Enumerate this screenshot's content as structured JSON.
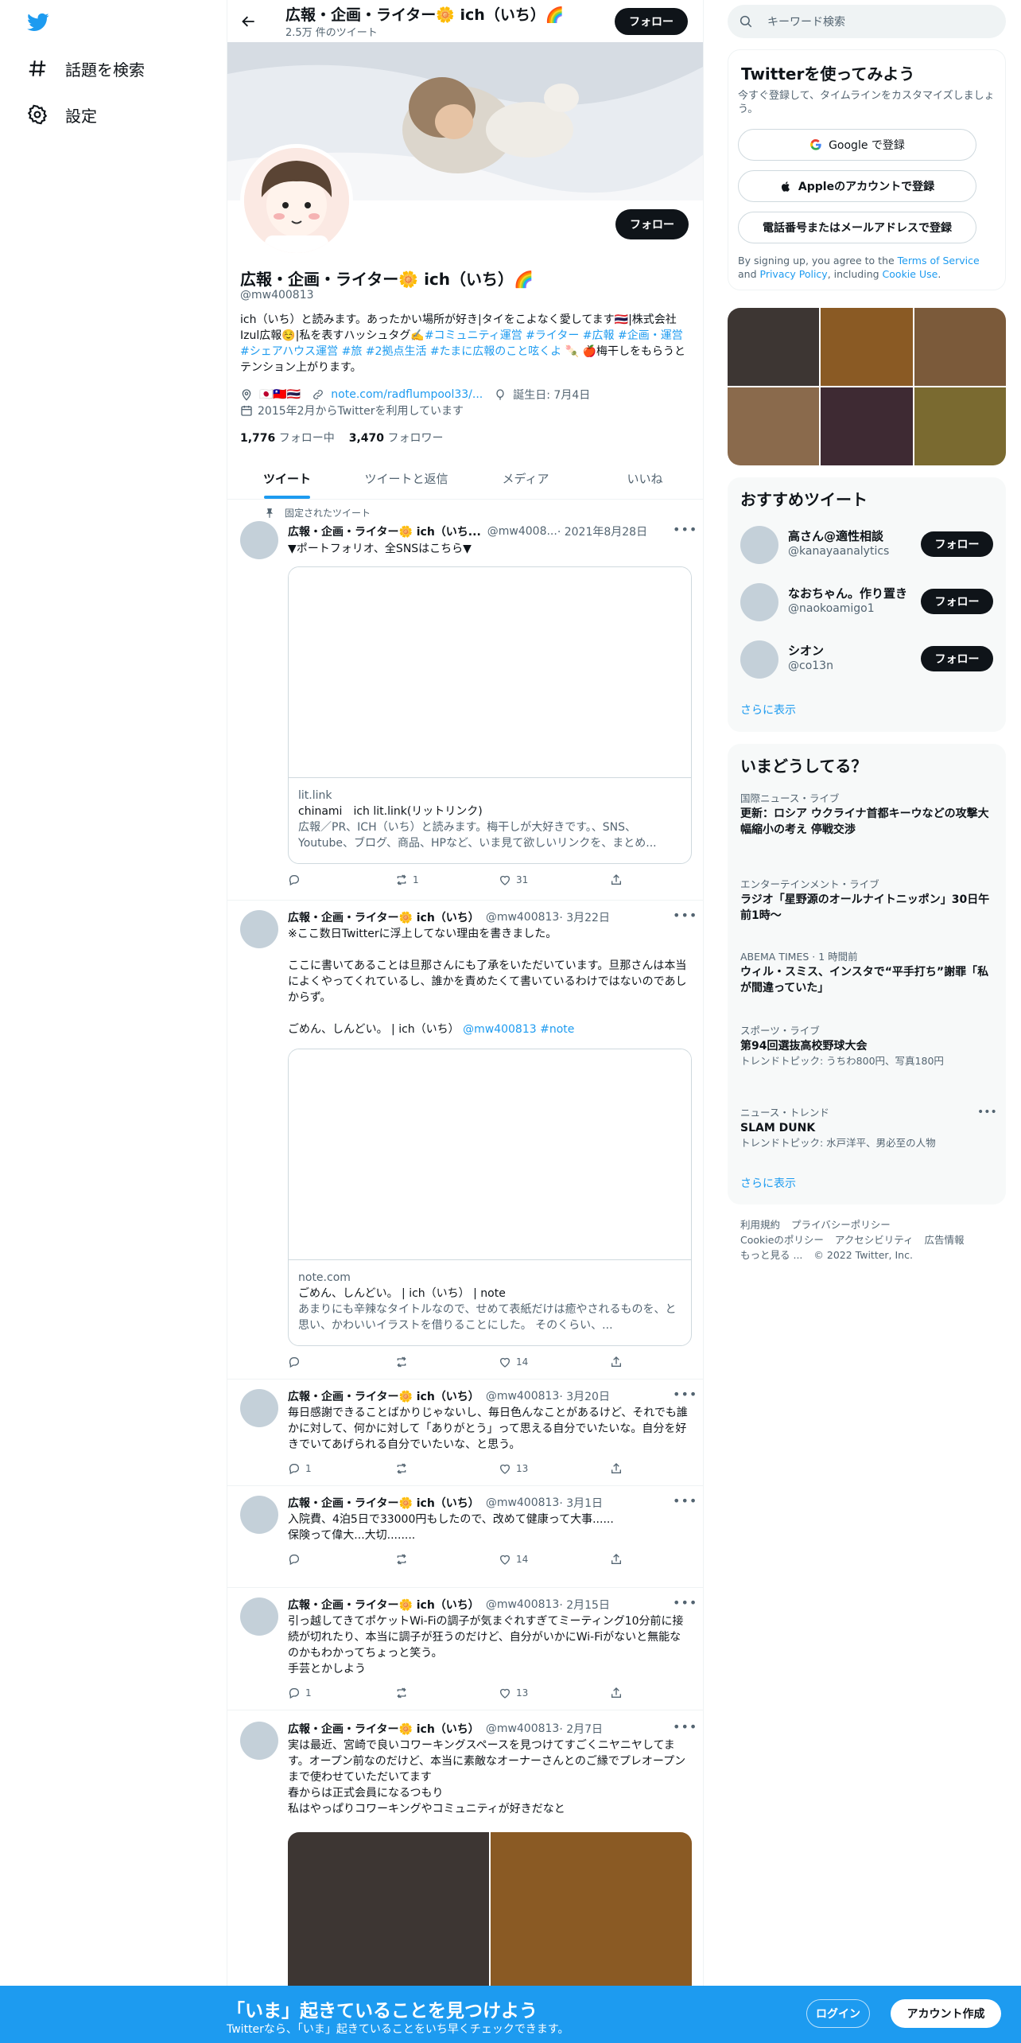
{
  "nav": {
    "explore_label": "話題を検索",
    "settings_label": "設定"
  },
  "topbar": {
    "name": "広報・企画・ライター🌼 ich（いち）🌈",
    "tweet_count": "2.5万 件のツイート",
    "follow_label": "フォロー"
  },
  "profile": {
    "name": "広報・企画・ライター🌼 ich（いち）🌈",
    "handle": "@mw400813",
    "follow_label": "フォロー",
    "bio_plain": "ich（いち）と読みます。あったかい場所が好き|タイをこよなく愛してます🇹🇭|株式会社Izul広報☺️|私を表すハッシュタグ✍️",
    "bio_tags": "#コミュニティ運営 #ライター #広報 #企画・運営 #シェアハウス運営 #旅 #2拠点生活 #たまに広報のこと呟くよ",
    "bio_tail": " 🍡 🍎梅干しをもらうとテンション上がります。",
    "location": "🇯🇵🇹🇼🇹🇭",
    "url": "note.com/radflumpool33/...",
    "birthday": "誕生日: 7月4日",
    "joined": "2015年2月からTwitterを利用しています",
    "following_count": "1,776",
    "following_label": "フォロー中",
    "followers_count": "3,470",
    "followers_label": "フォロワー"
  },
  "tabs": [
    "ツイート",
    "ツイートと返信",
    "メディア",
    "いいね"
  ],
  "pinned_label": "固定されたツイート",
  "tweets": [
    {
      "name": "広報・企画・ライター🌼 ich（いち...",
      "handle": "@mw4008...",
      "date": "· 2021年8月28日",
      "text": "▼ポートフォリオ、全SNSはこちら▼",
      "card": {
        "domain": "lit.link",
        "title": "chinami　ich lit.link(リットリンク)",
        "desc": "広報／PR、ICH（いち）と読みます。梅干しが大好きです。、SNS、Youtube、ブログ、商品、HPなど、いま見て欲しいリンクを、まとめ..."
      },
      "reply": "",
      "retweet": "1",
      "like": "31"
    },
    {
      "name": "広報・企画・ライター🌼 ich（いち）",
      "handle": "@mw400813",
      "date": "· 3月22日",
      "text": "※ここ数日Twitterに浮上してない理由を書きました。\n\nここに書いてあることは旦那さんにも了承をいただいています。旦那さんは本当によくやってくれているし、誰かを責めたくて書いているわけではないのであしからず。\n\nごめん、しんどい。 | ich（いち）",
      "text_link": "@mw400813 #note",
      "card": {
        "domain": "note.com",
        "title": "ごめん、しんどい。 | ich（いち） | note",
        "desc": "あまりにも辛辣なタイトルなので、せめて表紙だけは癒やされるものを、と思い、かわいいイラストを借りることにした。 そのくらい、..."
      },
      "reply": "",
      "retweet": "",
      "like": "14"
    },
    {
      "name": "広報・企画・ライター🌼 ich（いち）",
      "handle": "@mw400813",
      "date": "· 3月20日",
      "text": "毎日感謝できることばかりじゃないし、毎日色んなことがあるけど、それでも誰かに対して、何かに対して「ありがとう」って思える自分でいたいな。自分を好きでいてあげられる自分でいたいな、と思う。",
      "reply": "1",
      "retweet": "",
      "like": "13"
    },
    {
      "name": "広報・企画・ライター🌼 ich（いち）",
      "handle": "@mw400813",
      "date": "· 3月1日",
      "text": "入院費、4泊5日で33000円もしたので、改めて健康って大事......\n保険って偉大...大切........",
      "reply": "",
      "retweet": "",
      "like": "14"
    },
    {
      "name": "広報・企画・ライター🌼 ich（いち）",
      "handle": "@mw400813",
      "date": "· 2月15日",
      "text": "引っ越してきてポケットWi-Fiの調子が気まぐれすぎてミーティング10分前に接続が切れたり、本当に調子が狂うのだけど、自分がいかにWi-Fiがないと無能なのかもわかってちょっと笑う。\n手芸とかしよう",
      "reply": "1",
      "retweet": "",
      "like": "13"
    },
    {
      "name": "広報・企画・ライター🌼 ich（いち）",
      "handle": "@mw400813",
      "date": "· 2月7日",
      "text": "実は最近、宮崎で良いコワーキングスペースを見つけてすごくニヤニヤしてます。オープン前なのだけど、本当に素敵なオーナーさんとのご縁でプレオープンまで使わせていただいてます\n春からは正式会員になるつもり\n私はやっぱりコワーキングやコミュニティが好きだなと",
      "reply": "",
      "retweet": "",
      "like": ""
    }
  ],
  "search": {
    "placeholder": "キーワード検索"
  },
  "try_box": {
    "title": "Twitterを使ってみよう",
    "sub": "今すぐ登録して、タイムラインをカスタマイズしましょう。",
    "google_label": "Google で登録",
    "apple_label": "Appleのアカウントで登録",
    "phone_label": "電話番号またはメールアドレスで登録",
    "legal_pre": "By signing up, you agree to the ",
    "tos": "Terms of Service",
    "legal_and": " and ",
    "privacy": "Privacy Policy",
    "legal_mid": ", including ",
    "cookie": "Cookie Use",
    "legal_end": "."
  },
  "media_tile_colors": [
    "#3d3633",
    "#8a5a24",
    "#7b5a3a",
    "#8a6a4c",
    "#3e2a33",
    "#7a6a30"
  ],
  "recommend": {
    "title": "おすすめツイート",
    "follow_label": "フォロー",
    "users": [
      {
        "name": "高さん@適性相談",
        "handle": "@kanayaanalytics"
      },
      {
        "name": "なおちゃん。作り置き",
        "handle": "@naokoamigo1"
      },
      {
        "name": "シオン",
        "handle": "@co13n"
      }
    ],
    "more": "さらに表示"
  },
  "trends": {
    "title": "いまどうしてる？",
    "items": [
      {
        "cat": "国際ニュース・ライブ",
        "title": "更新：ロシア ウクライナ首都キーウなどの攻撃大幅縮小の考え 停戦交渉",
        "sub": ""
      },
      {
        "cat": "エンターテインメント・ライブ",
        "title": "ラジオ「星野源のオールナイトニッポン」30日午前1時〜",
        "sub": ""
      },
      {
        "cat": "ABEMA TIMES · 1 時間前",
        "title": "ウィル・スミス、インスタで“平手打ち”謝罪「私が間違っていた」",
        "sub": ""
      },
      {
        "cat": "スポーツ・ライブ",
        "title": "第94回選抜高校野球大会",
        "sub": "トレンドトピック: うちわ800円、写真180円"
      },
      {
        "cat": "ニュース・トレンド",
        "title": "SLAM DUNK",
        "sub": "トレンドトピック: 水戸洋平、男必至の人物"
      }
    ],
    "more": "さらに表示"
  },
  "footer": {
    "links": [
      "利用規約",
      "プライバシーポリシー",
      "Cookieのポリシー",
      "アクセシビリティ",
      "広告情報",
      "もっと見る ..."
    ],
    "copyright": "© 2022 Twitter, Inc."
  },
  "bottom": {
    "title": "「いま」起きていることを見つけよう",
    "sub": "Twitterなら、「いま」起きていることをいち早くチェックできます。",
    "login": "ログイン",
    "signup": "アカウント作成"
  },
  "colors": {
    "accent": "#1d9bf0",
    "dark": "#0f1419",
    "muted": "#536471"
  }
}
